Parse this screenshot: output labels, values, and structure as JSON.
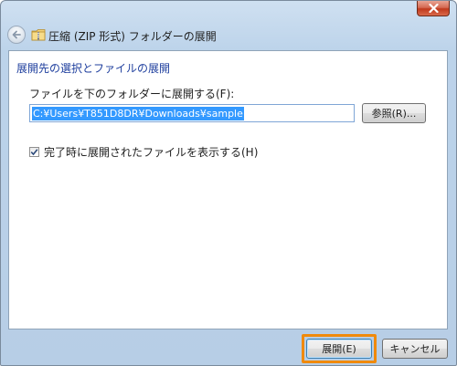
{
  "window": {
    "title": "圧縮 (ZIP 形式) フォルダーの展開"
  },
  "main": {
    "heading": "展開先の選択とファイルの展開",
    "dest_label": "ファイルを下のフォルダーに展開する(F):",
    "path_value": "C:¥Users¥T851D8DR¥Downloads¥sample",
    "browse_label": "参照(R)...",
    "checkbox_label": "完了時に展開されたファイルを表示する(H)",
    "checkbox_checked": true
  },
  "footer": {
    "extract_label": "展開(E)",
    "cancel_label": "キャンセル"
  },
  "colors": {
    "heading": "#1f3f9e",
    "highlight": "#f08a0c",
    "selection": "#3399ff",
    "close": "#c0391c"
  },
  "icons": [
    "close-icon",
    "back-arrow-icon",
    "zip-folder-icon",
    "checkmark-icon"
  ]
}
